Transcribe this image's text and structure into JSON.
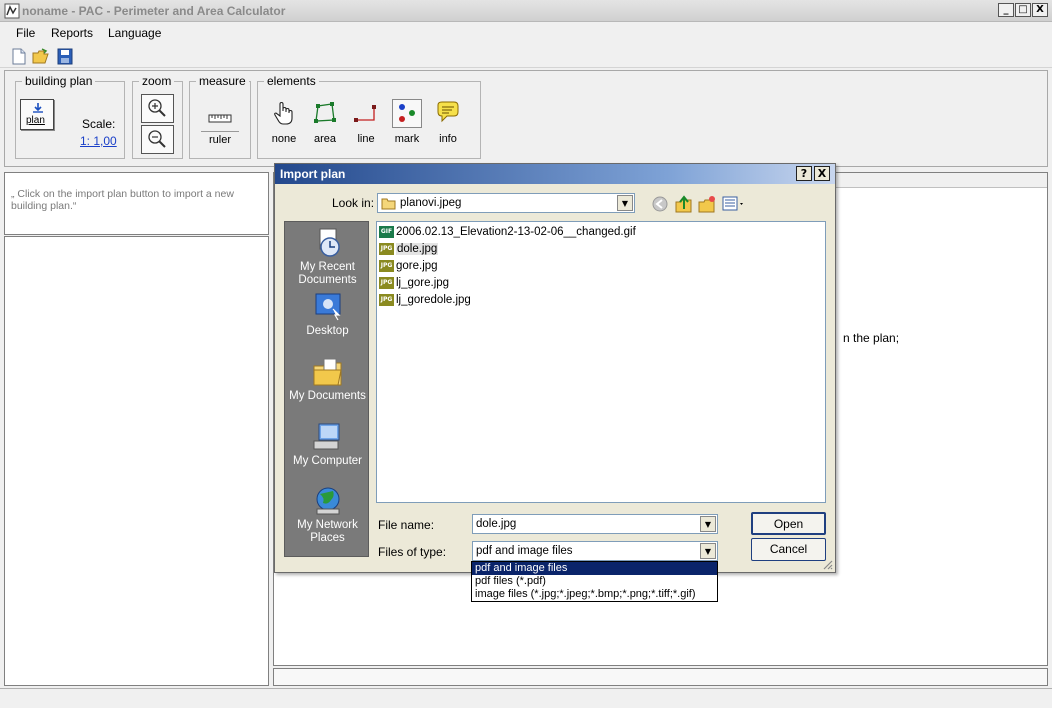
{
  "window": {
    "title": "noname - PAC - Perimeter and Area Calculator"
  },
  "window_buttons": {
    "minimize": "_",
    "maximize": "□",
    "close": "X"
  },
  "menu": {
    "items": [
      "File",
      "Reports",
      "Language"
    ]
  },
  "toolbar": {
    "icons": [
      "new-document-icon",
      "open-folder-icon",
      "save-disk-icon"
    ]
  },
  "ribbon": {
    "building_plan": {
      "label": "building plan",
      "button_label": "plan",
      "scale_label": "Scale:",
      "scale_value": "1: 1,00"
    },
    "zoom": {
      "label": "zoom"
    },
    "measure": {
      "label": "measure",
      "tools": [
        {
          "label": "ruler",
          "icon": "ruler-icon"
        }
      ]
    },
    "elements": {
      "label": "elements",
      "tools": [
        {
          "label": "none",
          "icon": "hand-pointer-icon"
        },
        {
          "label": "area",
          "icon": "area-polygon-icon"
        },
        {
          "label": "line",
          "icon": "line-icon"
        },
        {
          "label": "mark",
          "icon": "mark-dots-icon"
        },
        {
          "label": "info",
          "icon": "info-speech-icon"
        }
      ]
    }
  },
  "left_panel": {
    "hint": "„ Click on the import plan button to import a new building plan.“"
  },
  "right_panel": {
    "text": "n the plan;"
  },
  "dialog": {
    "title": "Import plan",
    "title_buttons": {
      "help": "?",
      "close": "X"
    },
    "look_in_label": "Look in:",
    "look_in_value": "planovi.jpeg",
    "places": [
      {
        "label": "My Recent Documents",
        "icon": "recent-documents-icon"
      },
      {
        "label": "Desktop",
        "icon": "desktop-icon"
      },
      {
        "label": "My Documents",
        "icon": "my-documents-icon"
      },
      {
        "label": "My Computer",
        "icon": "my-computer-icon"
      },
      {
        "label": "My Network Places",
        "icon": "network-places-icon"
      }
    ],
    "files": [
      {
        "name": "2006.02.13_Elevation2-13-02-06__changed.gif",
        "type": "GIF",
        "selected": false
      },
      {
        "name": "dole.jpg",
        "type": "JPG",
        "selected": true
      },
      {
        "name": "gore.jpg",
        "type": "JPG",
        "selected": false
      },
      {
        "name": "lj_gore.jpg",
        "type": "JPG",
        "selected": false
      },
      {
        "name": "lj_goredole.jpg",
        "type": "JPG",
        "selected": false
      }
    ],
    "file_name_label": "File name:",
    "file_name_value": "dole.jpg",
    "file_type_label": "Files of type:",
    "file_type_value": "pdf and image files",
    "file_type_options": [
      "pdf and image files",
      "pdf files (*.pdf)",
      "image files (*.jpg;*.jpeg;*.bmp;*.png;*.tiff;*.gif)"
    ],
    "open_label": "Open",
    "cancel_label": "Cancel"
  },
  "colors": {
    "accent": "#0a246a",
    "link": "#1a3fc8",
    "places_bg": "#7a7a7a",
    "dialog_bg": "#ece9d8"
  }
}
